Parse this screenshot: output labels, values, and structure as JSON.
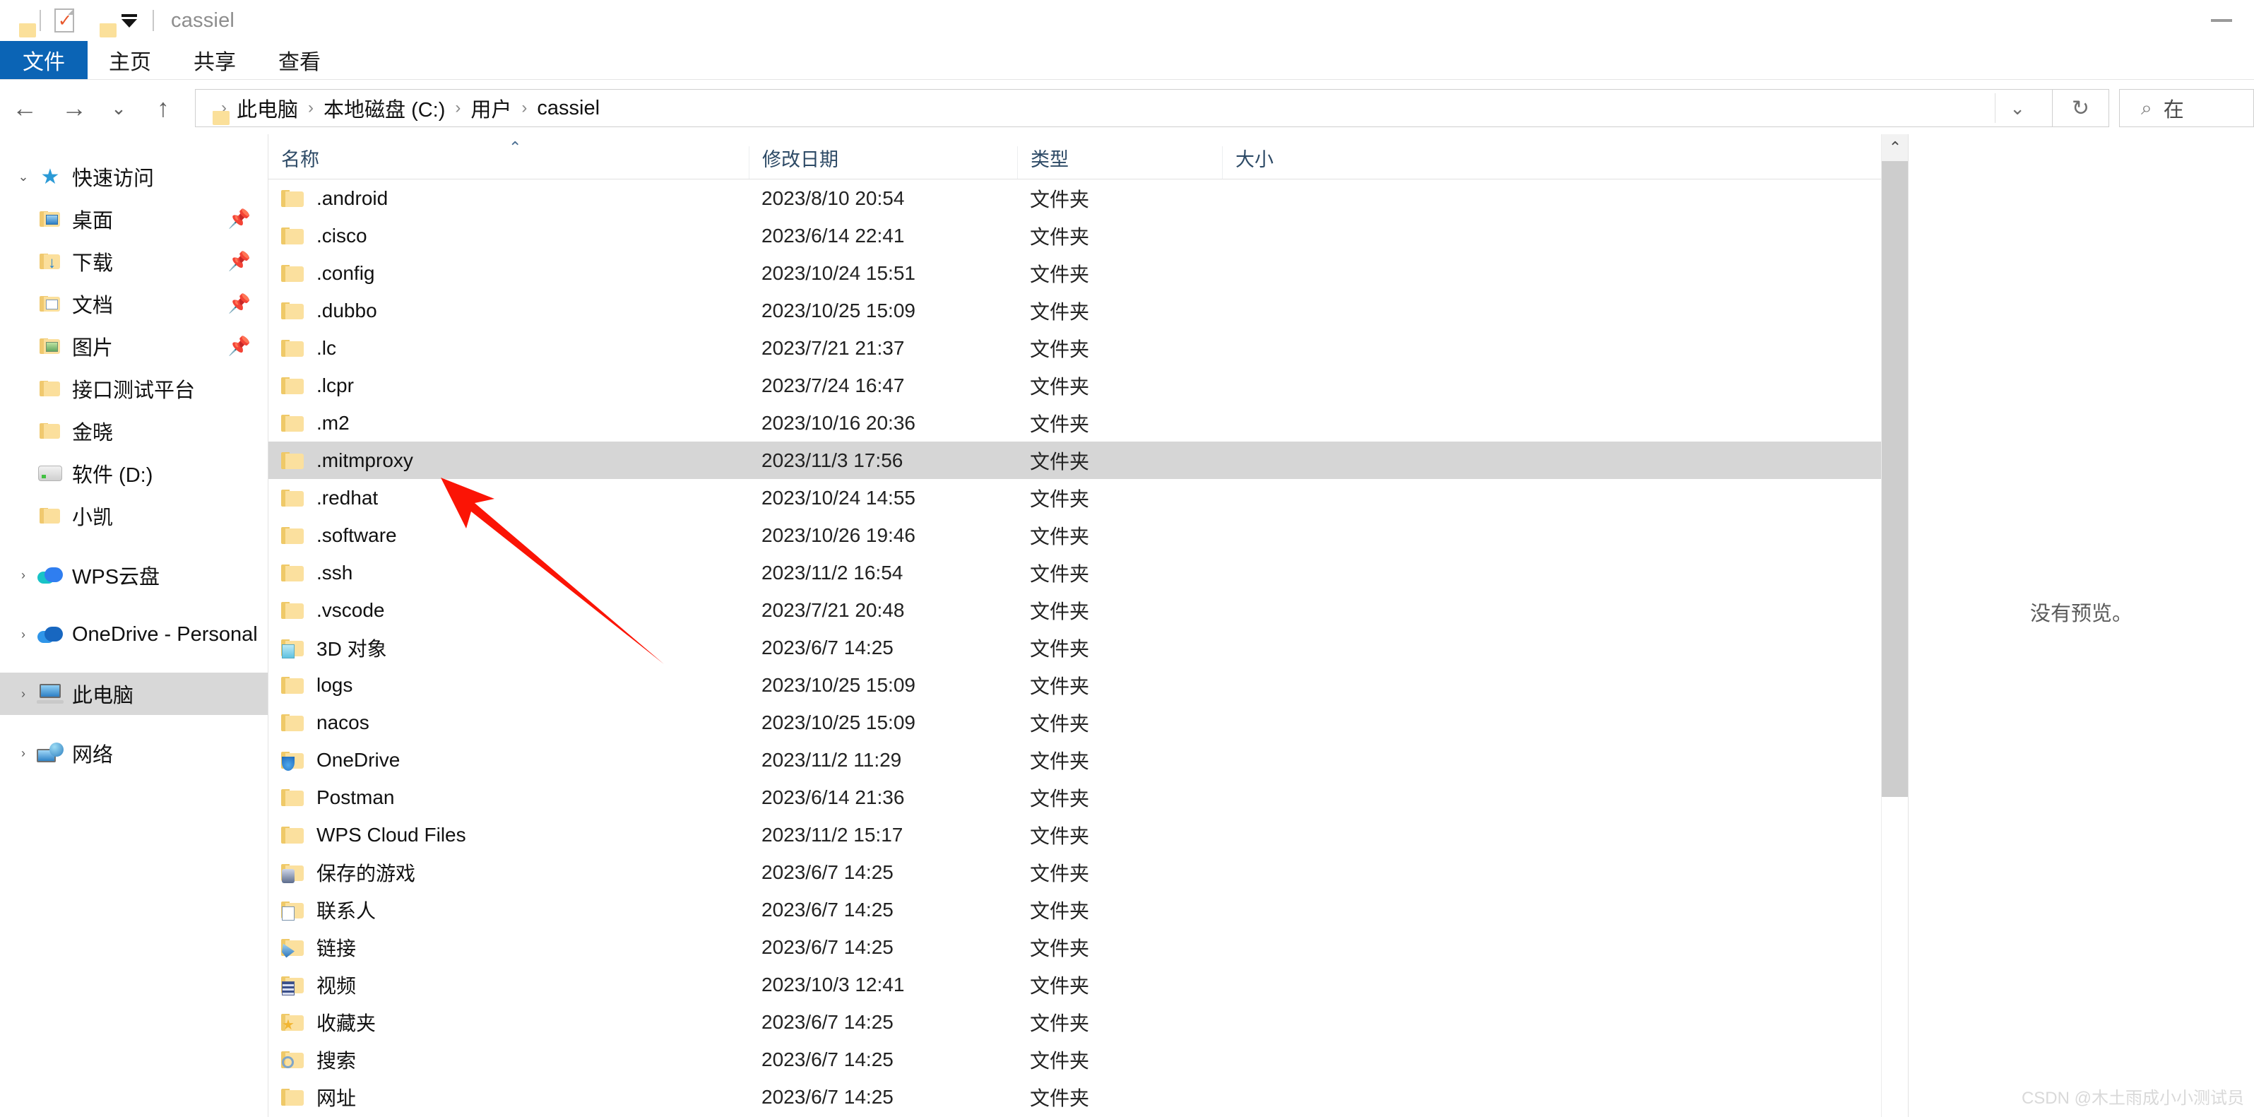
{
  "window": {
    "title": "cassiel",
    "quick_access_icons": [
      "folder-icon",
      "properties-icon",
      "new-folder-icon",
      "customize-caret-icon"
    ],
    "minimize_label": "—"
  },
  "ribbon": {
    "file_tab": "文件",
    "tabs": [
      "主页",
      "共享",
      "查看"
    ],
    "accent": "#0b64b5"
  },
  "navbar": {
    "back_icon": "back-arrow-icon",
    "forward_icon": "forward-arrow-icon",
    "recent_icon": "chevron-down-icon",
    "up_icon": "up-arrow-icon",
    "breadcrumb": [
      "此电脑",
      "本地磁盘 (C:)",
      "用户",
      "cassiel"
    ],
    "breadcrumb_separator": "›",
    "address_caret": "⌄",
    "refresh_icon": "refresh-icon",
    "search_icon": "search-icon",
    "search_placeholder": "在"
  },
  "sidebar": {
    "groups": [
      {
        "label": "快速访问",
        "icon": "star-icon",
        "expanded": true,
        "items": [
          {
            "label": "桌面",
            "icon": "folder-desktop-icon",
            "pinned": true
          },
          {
            "label": "下载",
            "icon": "folder-downloads-icon",
            "pinned": true
          },
          {
            "label": "文档",
            "icon": "folder-documents-icon",
            "pinned": true
          },
          {
            "label": "图片",
            "icon": "folder-pictures-icon",
            "pinned": true
          },
          {
            "label": "接口测试平台",
            "icon": "folder-icon",
            "pinned": false
          },
          {
            "label": "金晓",
            "icon": "folder-icon",
            "pinned": false
          },
          {
            "label": "软件 (D:)",
            "icon": "drive-icon",
            "pinned": false
          },
          {
            "label": "小凯",
            "icon": "folder-icon",
            "pinned": false
          }
        ]
      }
    ],
    "roots": [
      {
        "label": "WPS云盘",
        "icon": "wps-cloud-icon",
        "selected": false
      },
      {
        "label": "OneDrive - Personal",
        "icon": "onedrive-cloud-icon",
        "selected": false
      },
      {
        "label": "此电脑",
        "icon": "this-pc-icon",
        "selected": true
      },
      {
        "label": "网络",
        "icon": "network-icon",
        "selected": false
      }
    ]
  },
  "filelist": {
    "columns": [
      {
        "key": "name",
        "label": "名称",
        "sorted": true,
        "sort_dir": "asc"
      },
      {
        "key": "date",
        "label": "修改日期"
      },
      {
        "key": "type",
        "label": "类型"
      },
      {
        "key": "size",
        "label": "大小"
      }
    ],
    "sort_caret": "⌃",
    "rows": [
      {
        "name": ".android",
        "date": "2023/8/10 20:54",
        "type": "文件夹",
        "size": "",
        "icon": "folder-icon",
        "selected": false
      },
      {
        "name": ".cisco",
        "date": "2023/6/14 22:41",
        "type": "文件夹",
        "size": "",
        "icon": "folder-icon",
        "selected": false
      },
      {
        "name": ".config",
        "date": "2023/10/24 15:51",
        "type": "文件夹",
        "size": "",
        "icon": "folder-icon",
        "selected": false
      },
      {
        "name": ".dubbo",
        "date": "2023/10/25 15:09",
        "type": "文件夹",
        "size": "",
        "icon": "folder-icon",
        "selected": false
      },
      {
        "name": ".lc",
        "date": "2023/7/21 21:37",
        "type": "文件夹",
        "size": "",
        "icon": "folder-icon",
        "selected": false
      },
      {
        "name": ".lcpr",
        "date": "2023/7/24 16:47",
        "type": "文件夹",
        "size": "",
        "icon": "folder-icon",
        "selected": false
      },
      {
        "name": ".m2",
        "date": "2023/10/16 20:36",
        "type": "文件夹",
        "size": "",
        "icon": "folder-icon",
        "selected": false
      },
      {
        "name": ".mitmproxy",
        "date": "2023/11/3 17:56",
        "type": "文件夹",
        "size": "",
        "icon": "folder-icon",
        "selected": true
      },
      {
        "name": ".redhat",
        "date": "2023/10/24 14:55",
        "type": "文件夹",
        "size": "",
        "icon": "folder-icon",
        "selected": false
      },
      {
        "name": ".software",
        "date": "2023/10/26 19:46",
        "type": "文件夹",
        "size": "",
        "icon": "folder-icon",
        "selected": false
      },
      {
        "name": ".ssh",
        "date": "2023/11/2 16:54",
        "type": "文件夹",
        "size": "",
        "icon": "folder-icon",
        "selected": false
      },
      {
        "name": ".vscode",
        "date": "2023/7/21 20:48",
        "type": "文件夹",
        "size": "",
        "icon": "folder-icon",
        "selected": false
      },
      {
        "name": "3D 对象",
        "date": "2023/6/7 14:25",
        "type": "文件夹",
        "size": "",
        "icon": "folder-3dobjects-icon",
        "selected": false
      },
      {
        "name": "logs",
        "date": "2023/10/25 15:09",
        "type": "文件夹",
        "size": "",
        "icon": "folder-icon",
        "selected": false
      },
      {
        "name": "nacos",
        "date": "2023/10/25 15:09",
        "type": "文件夹",
        "size": "",
        "icon": "folder-icon",
        "selected": false
      },
      {
        "name": "OneDrive",
        "date": "2023/11/2 11:29",
        "type": "文件夹",
        "size": "",
        "icon": "folder-onedrive-icon",
        "selected": false
      },
      {
        "name": "Postman",
        "date": "2023/6/14 21:36",
        "type": "文件夹",
        "size": "",
        "icon": "folder-icon",
        "selected": false
      },
      {
        "name": "WPS Cloud Files",
        "date": "2023/11/2 15:17",
        "type": "文件夹",
        "size": "",
        "icon": "folder-icon",
        "selected": false
      },
      {
        "name": "保存的游戏",
        "date": "2023/6/7 14:25",
        "type": "文件夹",
        "size": "",
        "icon": "folder-savedgames-icon",
        "selected": false
      },
      {
        "name": "联系人",
        "date": "2023/6/7 14:25",
        "type": "文件夹",
        "size": "",
        "icon": "folder-contacts-icon",
        "selected": false
      },
      {
        "name": "链接",
        "date": "2023/6/7 14:25",
        "type": "文件夹",
        "size": "",
        "icon": "folder-links-icon",
        "selected": false
      },
      {
        "name": "视频",
        "date": "2023/10/3 12:41",
        "type": "文件夹",
        "size": "",
        "icon": "folder-videos-icon",
        "selected": false
      },
      {
        "name": "收藏夹",
        "date": "2023/6/7 14:25",
        "type": "文件夹",
        "size": "",
        "icon": "folder-favorites-icon",
        "selected": false
      },
      {
        "name": "搜索",
        "date": "2023/6/7 14:25",
        "type": "文件夹",
        "size": "",
        "icon": "folder-searches-icon",
        "selected": false
      },
      {
        "name": "网址",
        "date": "2023/6/7 14:25",
        "type": "文件夹",
        "size": "",
        "icon": "folder-icon",
        "selected": false
      }
    ],
    "scrollbar": {
      "up_arrow": "⌃",
      "thumb_visible": true
    }
  },
  "preview": {
    "message": "没有预览。"
  },
  "annotation": {
    "arrow_color": "#fb1405",
    "points_at": ".mitmproxy"
  },
  "watermark": {
    "text": "CSDN @木土雨成小小测试员"
  }
}
